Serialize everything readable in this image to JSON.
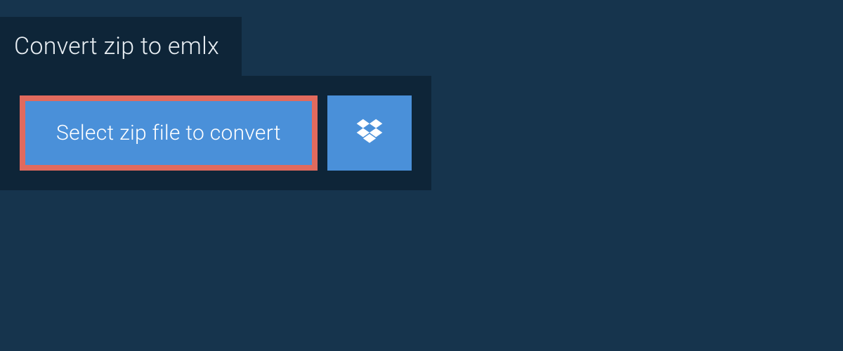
{
  "header": {
    "title": "Convert zip to emlx"
  },
  "actions": {
    "select_file_label": "Select zip file to convert"
  }
}
